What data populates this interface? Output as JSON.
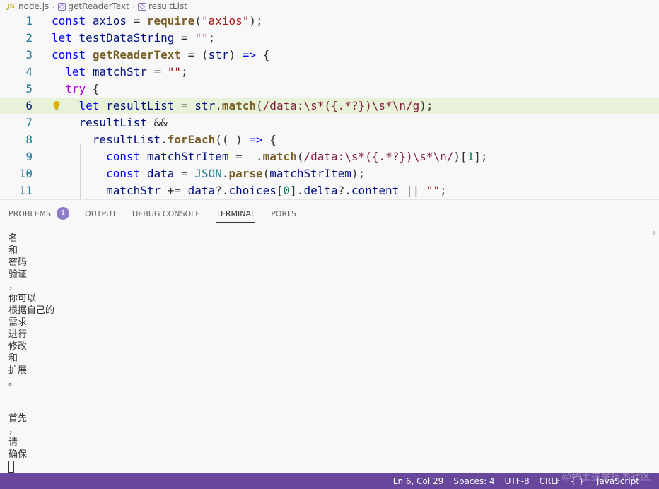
{
  "breadcrumb": {
    "lang_icon": "JS",
    "file": "node.js",
    "func": "getReaderText",
    "symbol": "resultList"
  },
  "editor": {
    "lines": [
      {
        "n": "1",
        "tokens": [
          [
            "kw",
            "const"
          ],
          [
            "op",
            " "
          ],
          [
            "var",
            "axios"
          ],
          [
            "op",
            " = "
          ],
          [
            "fn",
            "require"
          ],
          [
            "op",
            "("
          ],
          [
            "str",
            "\"axios\""
          ],
          [
            "op",
            ");"
          ]
        ]
      },
      {
        "n": "2",
        "tokens": [
          [
            "kw",
            "let"
          ],
          [
            "op",
            " "
          ],
          [
            "var",
            "testDataString"
          ],
          [
            "op",
            " = "
          ],
          [
            "str",
            "\"\""
          ],
          [
            "op",
            ";"
          ]
        ]
      },
      {
        "n": "3",
        "tokens": [
          [
            "kw",
            "const"
          ],
          [
            "op",
            " "
          ],
          [
            "fn",
            "getReaderText"
          ],
          [
            "op",
            " = ("
          ],
          [
            "var",
            "str"
          ],
          [
            "op",
            ") "
          ],
          [
            "kw",
            "=>"
          ],
          [
            "op",
            " {"
          ]
        ]
      },
      {
        "n": "4",
        "tokens": [
          [
            "op",
            "  "
          ],
          [
            "kw",
            "let"
          ],
          [
            "op",
            " "
          ],
          [
            "var",
            "matchStr"
          ],
          [
            "op",
            " = "
          ],
          [
            "str",
            "\"\""
          ],
          [
            "op",
            ";"
          ]
        ]
      },
      {
        "n": "5",
        "tokens": [
          [
            "op",
            "  "
          ],
          [
            "kw2",
            "try"
          ],
          [
            "op",
            " {"
          ]
        ]
      },
      {
        "n": "6",
        "tokens": [
          [
            "op",
            "    "
          ],
          [
            "kw",
            "let"
          ],
          [
            "op",
            " "
          ],
          [
            "var",
            "resultList"
          ],
          [
            "op",
            " = "
          ],
          [
            "var",
            "str"
          ],
          [
            "op",
            "."
          ],
          [
            "fn",
            "match"
          ],
          [
            "op",
            "("
          ],
          [
            "reg",
            "/data:\\s*({.*?})\\s*\\n/g"
          ],
          [
            "op",
            ");"
          ]
        ],
        "active": true
      },
      {
        "n": "7",
        "tokens": [
          [
            "op",
            "    "
          ],
          [
            "var",
            "resultList"
          ],
          [
            "op",
            " &&"
          ]
        ]
      },
      {
        "n": "8",
        "tokens": [
          [
            "op",
            "      "
          ],
          [
            "var",
            "resultList"
          ],
          [
            "op",
            "."
          ],
          [
            "fn",
            "forEach"
          ],
          [
            "op",
            "(("
          ],
          [
            "var",
            "_"
          ],
          [
            "op",
            ") "
          ],
          [
            "kw",
            "=>"
          ],
          [
            "op",
            " {"
          ]
        ]
      },
      {
        "n": "9",
        "tokens": [
          [
            "op",
            "        "
          ],
          [
            "kw",
            "const"
          ],
          [
            "op",
            " "
          ],
          [
            "var",
            "matchStrItem"
          ],
          [
            "op",
            " = "
          ],
          [
            "var",
            "_"
          ],
          [
            "op",
            "."
          ],
          [
            "fn",
            "match"
          ],
          [
            "op",
            "("
          ],
          [
            "reg",
            "/data:\\s*({.*?})\\s*\\n/"
          ],
          [
            "op",
            ")["
          ],
          [
            "num",
            "1"
          ],
          [
            "op",
            "];"
          ]
        ]
      },
      {
        "n": "10",
        "tokens": [
          [
            "op",
            "        "
          ],
          [
            "kw",
            "const"
          ],
          [
            "op",
            " "
          ],
          [
            "var",
            "data"
          ],
          [
            "op",
            " = "
          ],
          [
            "cls",
            "JSON"
          ],
          [
            "op",
            "."
          ],
          [
            "fn",
            "parse"
          ],
          [
            "op",
            "("
          ],
          [
            "var",
            "matchStrItem"
          ],
          [
            "op",
            ");"
          ]
        ]
      },
      {
        "n": "11",
        "tokens": [
          [
            "op",
            "        "
          ],
          [
            "var",
            "matchStr"
          ],
          [
            "op",
            " += "
          ],
          [
            "var",
            "data"
          ],
          [
            "op",
            "?."
          ],
          [
            "var",
            "choices"
          ],
          [
            "op",
            "["
          ],
          [
            "num",
            "0"
          ],
          [
            "op",
            "]."
          ],
          [
            "var",
            "delta"
          ],
          [
            "op",
            "?."
          ],
          [
            "var",
            "content"
          ],
          [
            "op",
            " || "
          ],
          [
            "str",
            "\"\""
          ],
          [
            "op",
            ";"
          ]
        ]
      }
    ]
  },
  "panel": {
    "tabs": [
      {
        "label": "PROBLEMS",
        "badge": "1"
      },
      {
        "label": "OUTPUT"
      },
      {
        "label": "DEBUG CONSOLE"
      },
      {
        "label": "TERMINAL",
        "active": true
      },
      {
        "label": "PORTS"
      }
    ],
    "terminal_lines": [
      "名",
      "和",
      "密码",
      "验证",
      "，",
      "你可以",
      "根据自己的",
      "需求",
      "进行",
      "修改",
      "和",
      "扩展",
      "。",
      "",
      "",
      "首先",
      "，",
      "请",
      "确保"
    ]
  },
  "status": {
    "position": "Ln 6, Col 29",
    "spaces": "Spaces: 4",
    "encoding": "UTF-8",
    "eol": "CRLF",
    "language": "JavaScript",
    "language_icon": "{ }"
  },
  "watermark": "@稀土掘金技术社区",
  "colors": {
    "status_bar": "#68479d",
    "active_line": "#e8f2d8",
    "keyword": "#0000ff",
    "function": "#795e26",
    "string": "#a31515",
    "regex": "#811f3f"
  }
}
